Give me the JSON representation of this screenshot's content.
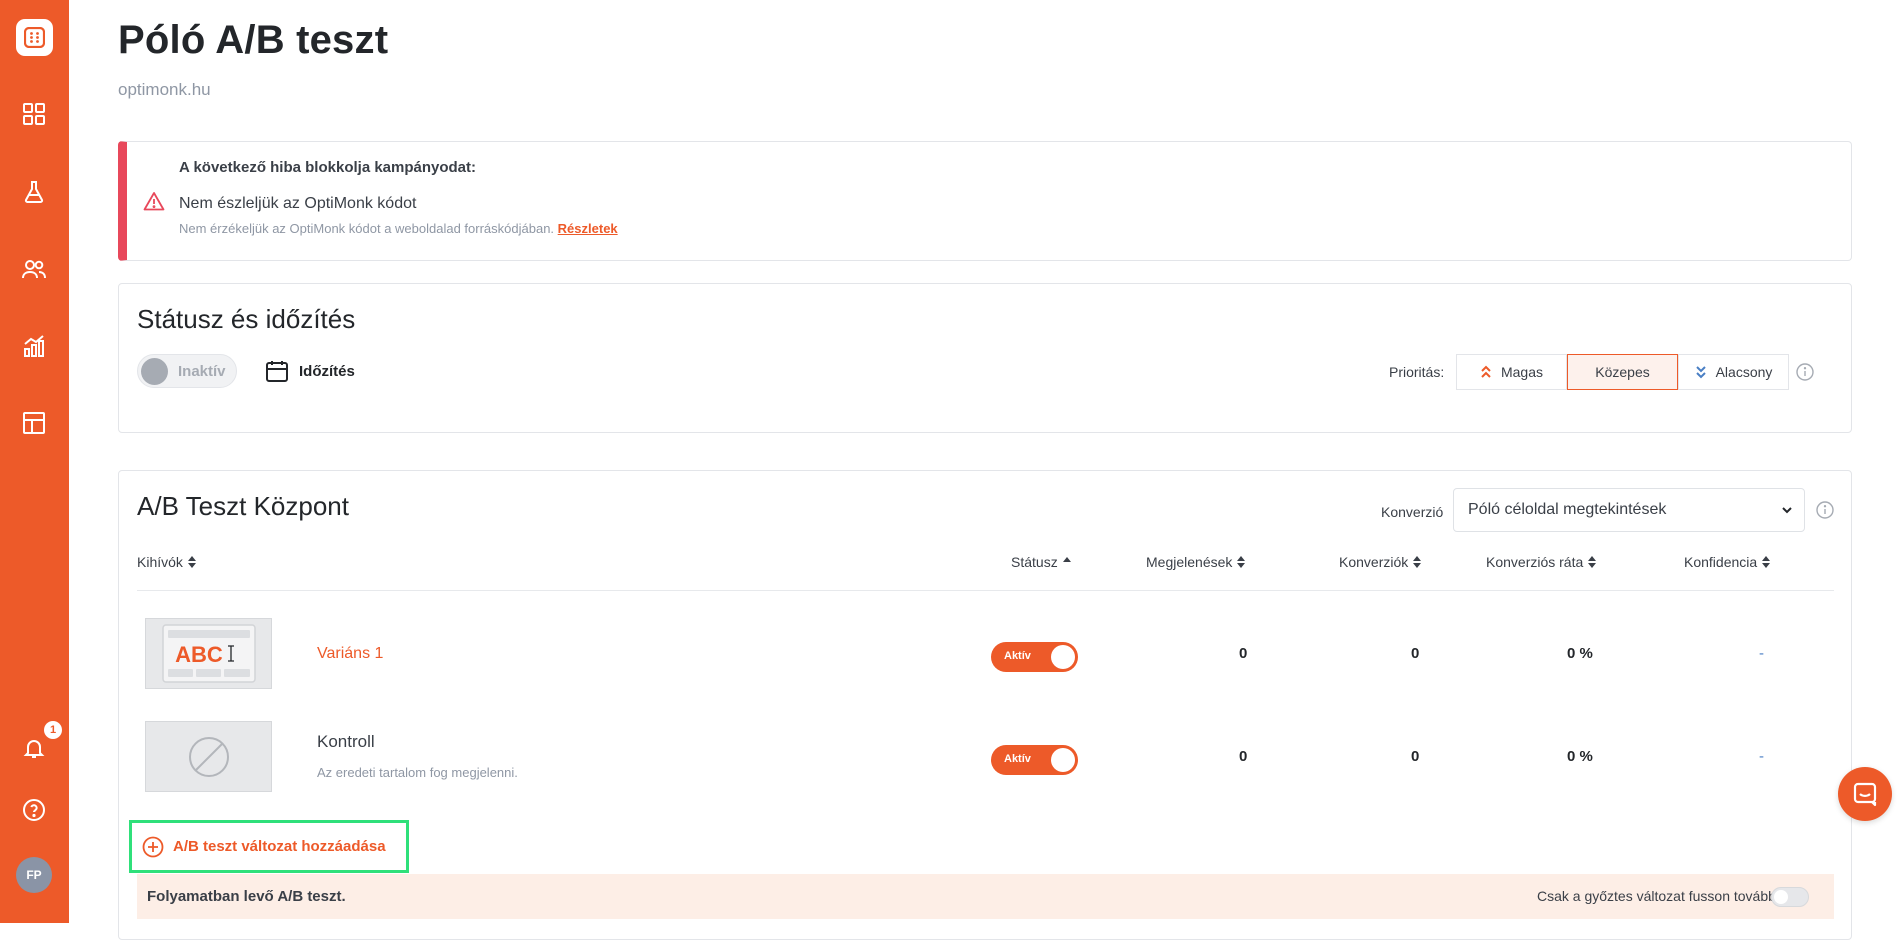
{
  "sidebar": {
    "items": [
      {
        "name": "dashboard-grid-icon"
      },
      {
        "name": "experiments-flask-icon"
      },
      {
        "name": "users-icon"
      },
      {
        "name": "analytics-chart-icon"
      },
      {
        "name": "templates-layout-icon"
      }
    ],
    "notifications_count": "1",
    "avatar_initials": "FP"
  },
  "header": {
    "title": "Póló A/B teszt",
    "domain": "optimonk.hu"
  },
  "error": {
    "heading": "A következő hiba blokkolja kampányodat:",
    "title": "Nem észleljük az OptiMonk kódot",
    "description": "Nem érzékeljük az OptiMonk kódot a weboldalad forráskódjában.",
    "link_label": "Részletek"
  },
  "status": {
    "title": "Státusz és időzítés",
    "toggle_label": "Inaktív",
    "schedule_label": "Időzítés",
    "priority_label": "Prioritás:",
    "priority_options": [
      {
        "label": "Magas",
        "icon": "double-chevron-up-icon"
      },
      {
        "label": "Közepes",
        "selected": true
      },
      {
        "label": "Alacsony",
        "icon": "double-chevron-down-icon"
      }
    ]
  },
  "ab": {
    "title": "A/B Teszt Központ",
    "conversion_label": "Konverzió",
    "conversion_value": "Póló céloldal megtekintések",
    "columns": {
      "challengers": "Kihívók",
      "status": "Státusz",
      "impressions": "Megjelenések",
      "conversions": "Konverziók",
      "conversion_rate": "Konverziós ráta",
      "confidence": "Konfidencia"
    },
    "rows": [
      {
        "name": "Variáns 1",
        "thumb_text": "ABC",
        "status": "Aktív",
        "impressions": "0",
        "conversions": "0",
        "rate": "0 %",
        "confidence": "-"
      },
      {
        "name": "Kontroll",
        "description": "Az eredeti tartalom fog megjelenni.",
        "status": "Aktív",
        "impressions": "0",
        "conversions": "0",
        "rate": "0 %",
        "confidence": "-"
      }
    ],
    "add_variant_label": "A/B teszt változat hozzáadása",
    "progress_label": "Folyamatban levő A/B teszt.",
    "winner_label": "Csak a győztes változat fusson tovább"
  },
  "colors": {
    "brand": "#ed5a29",
    "error": "#e8485b",
    "highlight": "#2fe07a"
  }
}
